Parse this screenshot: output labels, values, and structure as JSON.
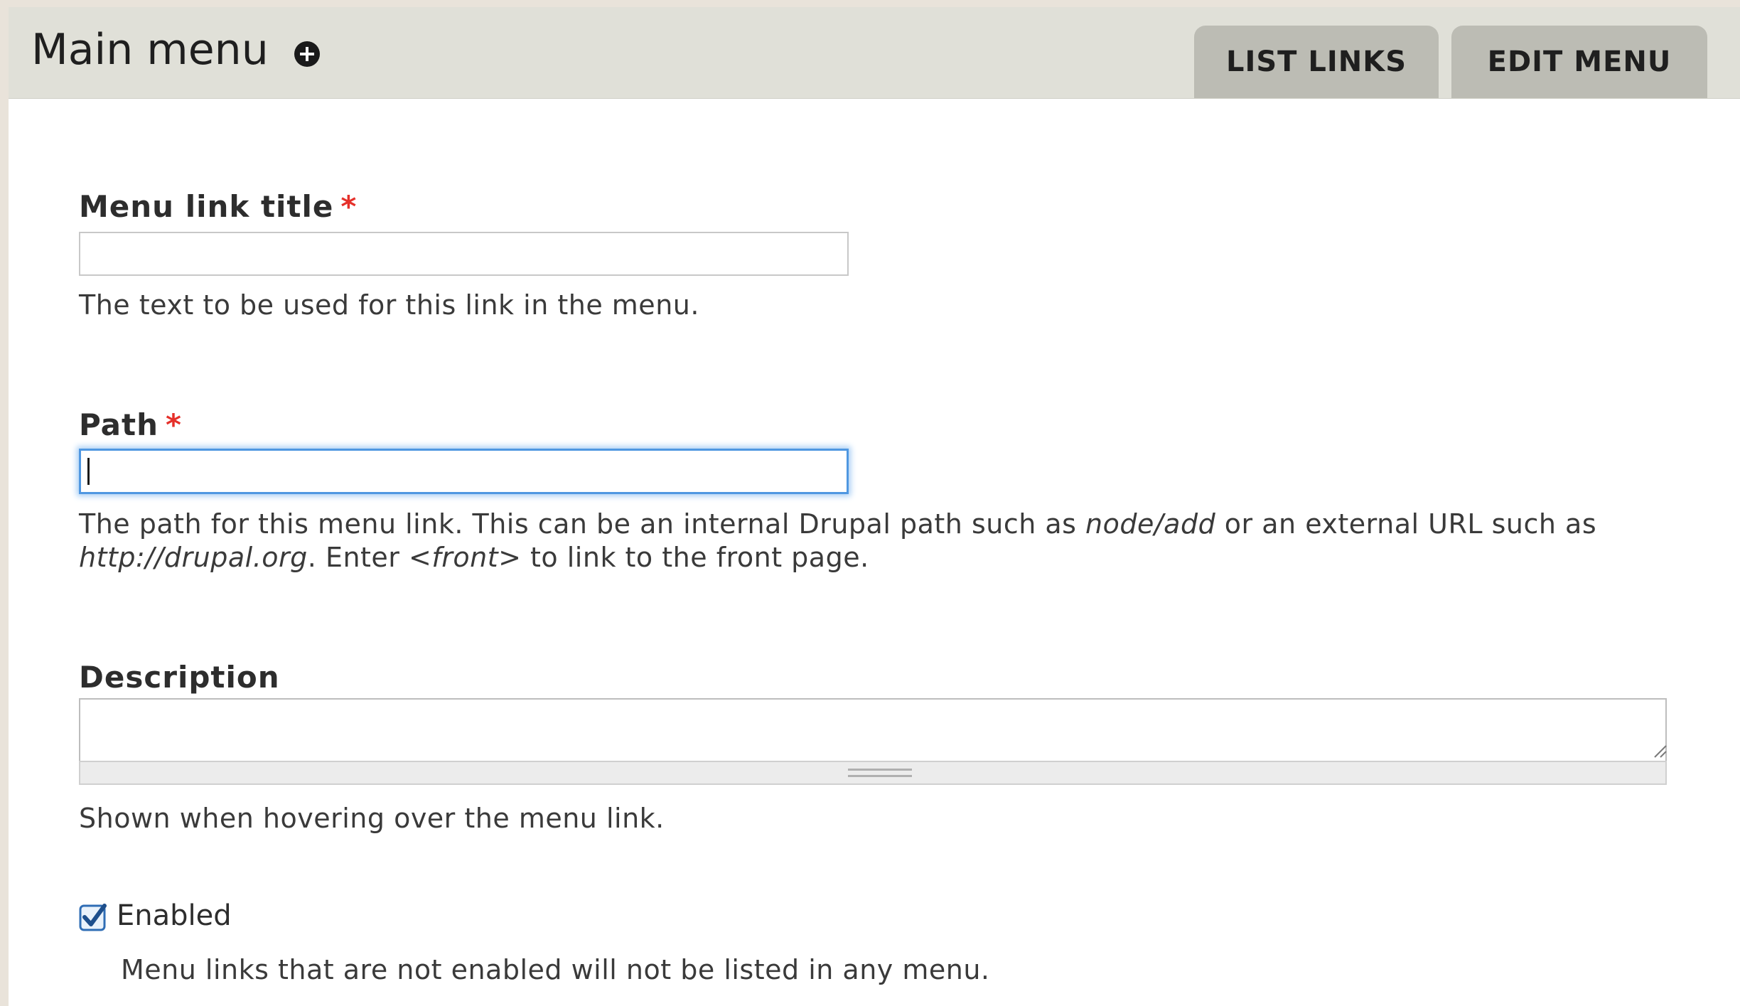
{
  "header": {
    "title": "Main menu",
    "add_icon": "add-circle-icon",
    "tabs": [
      {
        "label": "LIST LINKS"
      },
      {
        "label": "EDIT MENU"
      }
    ]
  },
  "form": {
    "menu_link_title": {
      "label": "Menu link title",
      "required_marker": "*",
      "value": "",
      "help": "The text to be used for this link in the menu."
    },
    "path": {
      "label": "Path",
      "required_marker": "*",
      "value": "",
      "help_line1_a": "The path for this menu link. This can be an internal Drupal path such as ",
      "help_line1_em": "node/add",
      "help_line1_b": " or an external URL such as",
      "help_line2_em1": "http://drupal.org",
      "help_line2_a": ". Enter ",
      "help_line2_em2": "<front>",
      "help_line2_b": " to link to the front page."
    },
    "description": {
      "label": "Description",
      "value": "",
      "help": "Shown when hovering over the menu link."
    },
    "enabled": {
      "label": "Enabled",
      "checked": true,
      "help": "Menu links that are not enabled will not be listed in any menu."
    }
  },
  "colors": {
    "required": "#e5302a",
    "focus_border": "#4f97e1",
    "tab_bg": "#bcbcb4",
    "header_bg": "#e0e0d8",
    "checkbox": "#2f6db5"
  }
}
